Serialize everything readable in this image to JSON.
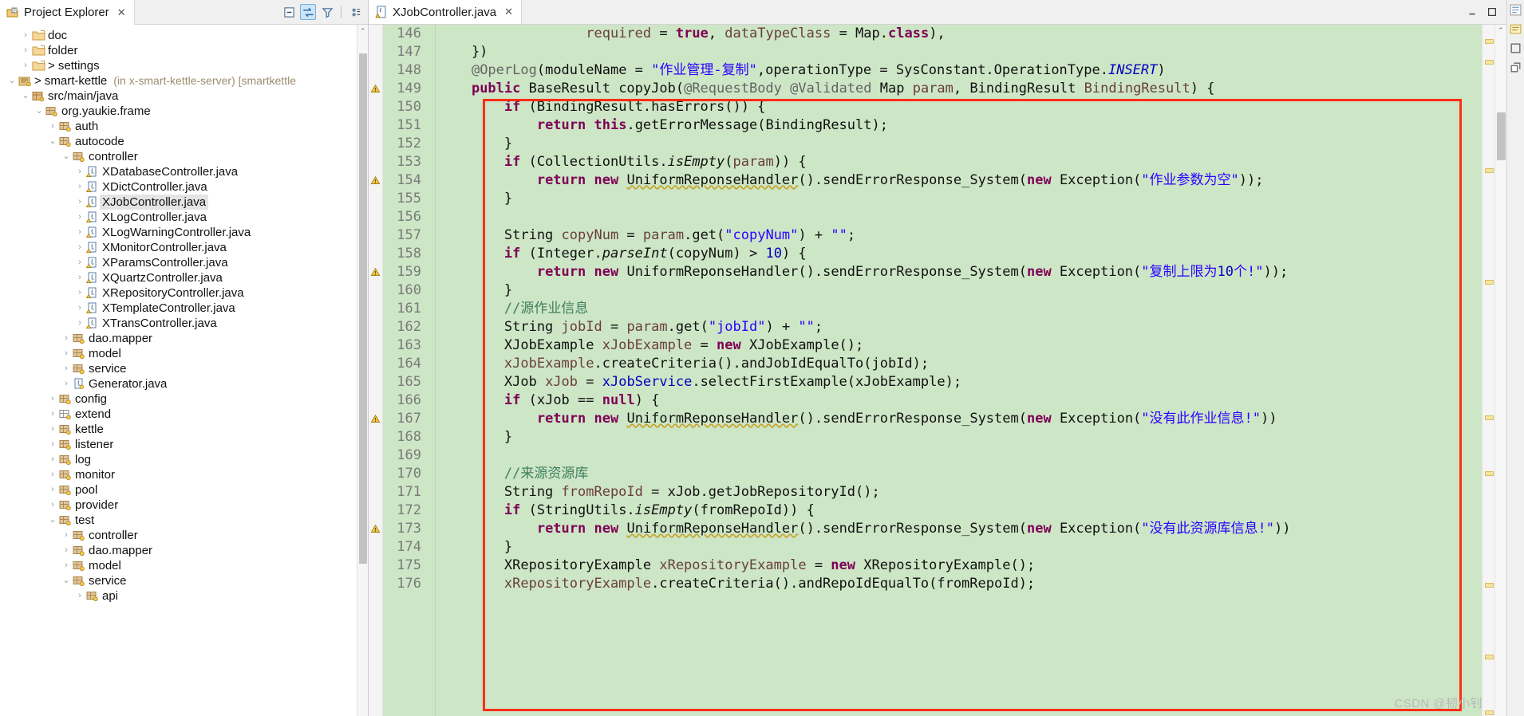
{
  "explorer": {
    "tab_title": "Project Explorer",
    "tab_close": "✕",
    "toolbar": [
      {
        "name": "collapse-all-icon",
        "title": "Collapse All"
      },
      {
        "name": "link-with-editor-icon",
        "title": "Link with Editor"
      },
      {
        "name": "view-menu-filter-icon",
        "title": "Filters"
      },
      {
        "name": "view-menu-icon",
        "title": "View Menu"
      }
    ],
    "tree": [
      {
        "label": "doc",
        "indent": 1,
        "twisty": "collapsed",
        "icon": "folder-icon"
      },
      {
        "label": "folder",
        "indent": 1,
        "twisty": "collapsed",
        "icon": "folder-icon"
      },
      {
        "label": "> settings",
        "indent": 1,
        "twisty": "collapsed",
        "icon": "folder-icon"
      },
      {
        "label": "> smart-kettle",
        "sub": "(in x-smart-kettle-server) [smartkettle",
        "indent": 0,
        "twisty": "expanded",
        "icon": "java-project-icon"
      },
      {
        "label": "src/main/java",
        "indent": 1,
        "twisty": "expanded",
        "icon": "source-folder-icon"
      },
      {
        "label": "org.yaukie.frame",
        "indent": 2,
        "twisty": "expanded",
        "icon": "package-icon"
      },
      {
        "label": "auth",
        "indent": 3,
        "twisty": "collapsed",
        "icon": "package-icon"
      },
      {
        "label": "autocode",
        "indent": 3,
        "twisty": "expanded",
        "icon": "package-icon"
      },
      {
        "label": "controller",
        "indent": 4,
        "twisty": "expanded",
        "icon": "package-icon"
      },
      {
        "label": "XDatabaseController.java",
        "indent": 5,
        "twisty": "collapsed",
        "icon": "java-file-warning-icon"
      },
      {
        "label": "XDictController.java",
        "indent": 5,
        "twisty": "collapsed",
        "icon": "java-file-warning-icon"
      },
      {
        "label": "XJobController.java",
        "indent": 5,
        "twisty": "collapsed",
        "icon": "java-file-warning-icon",
        "selected": true
      },
      {
        "label": "XLogController.java",
        "indent": 5,
        "twisty": "collapsed",
        "icon": "java-file-warning-icon"
      },
      {
        "label": "XLogWarningController.java",
        "indent": 5,
        "twisty": "collapsed",
        "icon": "java-file-warning-icon"
      },
      {
        "label": "XMonitorController.java",
        "indent": 5,
        "twisty": "collapsed",
        "icon": "java-file-warning-icon"
      },
      {
        "label": "XParamsController.java",
        "indent": 5,
        "twisty": "collapsed",
        "icon": "java-file-warning-icon"
      },
      {
        "label": "XQuartzController.java",
        "indent": 5,
        "twisty": "collapsed",
        "icon": "java-file-warning-icon"
      },
      {
        "label": "XRepositoryController.java",
        "indent": 5,
        "twisty": "collapsed",
        "icon": "java-file-warning-icon"
      },
      {
        "label": "XTemplateController.java",
        "indent": 5,
        "twisty": "collapsed",
        "icon": "java-file-warning-icon"
      },
      {
        "label": "XTransController.java",
        "indent": 5,
        "twisty": "collapsed",
        "icon": "java-file-warning-icon"
      },
      {
        "label": "dao.mapper",
        "indent": 4,
        "twisty": "collapsed",
        "icon": "package-icon"
      },
      {
        "label": "model",
        "indent": 4,
        "twisty": "collapsed",
        "icon": "package-icon"
      },
      {
        "label": "service",
        "indent": 4,
        "twisty": "collapsed",
        "icon": "package-icon"
      },
      {
        "label": "Generator.java",
        "indent": 4,
        "twisty": "collapsed",
        "icon": "java-file-icon"
      },
      {
        "label": "config",
        "indent": 3,
        "twisty": "collapsed",
        "icon": "package-icon"
      },
      {
        "label": "extend",
        "indent": 3,
        "twisty": "collapsed",
        "icon": "package-empty-icon"
      },
      {
        "label": "kettle",
        "indent": 3,
        "twisty": "collapsed",
        "icon": "package-icon"
      },
      {
        "label": "listener",
        "indent": 3,
        "twisty": "collapsed",
        "icon": "package-icon"
      },
      {
        "label": "log",
        "indent": 3,
        "twisty": "collapsed",
        "icon": "package-icon"
      },
      {
        "label": "monitor",
        "indent": 3,
        "twisty": "collapsed",
        "icon": "package-icon"
      },
      {
        "label": "pool",
        "indent": 3,
        "twisty": "collapsed",
        "icon": "package-icon"
      },
      {
        "label": "provider",
        "indent": 3,
        "twisty": "collapsed",
        "icon": "package-icon"
      },
      {
        "label": "test",
        "indent": 3,
        "twisty": "expanded",
        "icon": "package-icon"
      },
      {
        "label": "controller",
        "indent": 4,
        "twisty": "collapsed",
        "icon": "package-icon"
      },
      {
        "label": "dao.mapper",
        "indent": 4,
        "twisty": "collapsed",
        "icon": "package-icon"
      },
      {
        "label": "model",
        "indent": 4,
        "twisty": "collapsed",
        "icon": "package-icon"
      },
      {
        "label": "service",
        "indent": 4,
        "twisty": "expanded",
        "icon": "package-icon"
      },
      {
        "label": "api",
        "indent": 5,
        "twisty": "collapsed",
        "icon": "package-icon"
      }
    ],
    "scrollbar": {
      "up_arrow": "⌃",
      "down_arrow": "⌄"
    }
  },
  "editor": {
    "tab_title": "XJobController.java",
    "tab_close": "✕",
    "tab_icon": "java-file-warning-icon",
    "first_line": 146,
    "lines": [
      {
        "n": 146,
        "annot": "",
        "html": "                  <span class=\"param\">required</span> = <span class=\"kw\">true</span>, <span class=\"param\">dataTypeClass</span> = Map.<span class=\"kw\">class</span>),"
      },
      {
        "n": 147,
        "annot": "",
        "html": "    })"
      },
      {
        "n": 148,
        "annot": "",
        "html": "    <span class=\"ann\">@OperLog</span>(moduleName = <span class=\"str\">\"作业管理-复制\"</span>,operationType = SysConstant.OperationType.<span class=\"fld stat\">INSERT</span>)"
      },
      {
        "n": 149,
        "annot": "warning",
        "html": "    <span class=\"kw\">public</span> BaseResult copyJob(<span class=\"ann\">@RequestBody</span> <span class=\"ann\">@Validated</span> Map <span class=\"param\">param</span>, BindingResult <span class=\"param\">BindingResult</span>) {"
      },
      {
        "n": 150,
        "annot": "",
        "html": "        <span class=\"kw\">if</span> (BindingResult.hasErrors()) {"
      },
      {
        "n": 151,
        "annot": "",
        "html": "            <span class=\"kw\">return</span> <span class=\"kw\">this</span>.getErrorMessage(BindingResult);"
      },
      {
        "n": 152,
        "annot": "",
        "html": "        }"
      },
      {
        "n": 153,
        "annot": "",
        "html": "        <span class=\"kw\">if</span> (CollectionUtils.<span class=\"stat\">isEmpty</span>(<span class=\"param\">param</span>)) {"
      },
      {
        "n": 154,
        "annot": "warning",
        "html": "            <span class=\"kw\">return</span> <span class=\"kw\">new</span> <span class=\"wavy\">UniformReponseHandler</span>().sendErrorResponse_System(<span class=\"kw\">new</span> Exception(<span class=\"str\">\"作业参数为空\"</span>));"
      },
      {
        "n": 155,
        "annot": "",
        "html": "        }"
      },
      {
        "n": 156,
        "annot": "",
        "html": ""
      },
      {
        "n": 157,
        "annot": "",
        "html": "        String <span class=\"param\">copyNum</span> = <span class=\"param\">param</span>.get(<span class=\"str\">\"copyNum\"</span>) + <span class=\"str\">\"\"</span>;"
      },
      {
        "n": 158,
        "annot": "",
        "html": "        <span class=\"kw\">if</span> (Integer.<span class=\"stat\">parseInt</span>(copyNum) &gt; <span class=\"fld\">10</span>) {"
      },
      {
        "n": 159,
        "annot": "warning",
        "html": "            <span class=\"kw\">return</span> <span class=\"kw\">new</span> UniformReponseHandler().sendErrorResponse_System(<span class=\"kw\">new</span> Exception(<span class=\"str\">\"复制上限为</span><span class=\"fld\">10</span><span class=\"str\">个!\"</span>));"
      },
      {
        "n": 160,
        "annot": "",
        "html": "        }"
      },
      {
        "n": 161,
        "annot": "",
        "html": "        <span class=\"cmt\">//源作业信息</span>"
      },
      {
        "n": 162,
        "annot": "",
        "html": "        String <span class=\"param\">jobId</span> = <span class=\"param\">param</span>.get(<span class=\"str\">\"jobId\"</span>) + <span class=\"str\">\"\"</span>;"
      },
      {
        "n": 163,
        "annot": "",
        "html": "        XJobExample <span class=\"param\">xJobExample</span> = <span class=\"kw\">new</span> XJobExample();"
      },
      {
        "n": 164,
        "annot": "",
        "html": "        <span class=\"param\">xJobExample</span>.createCriteria().andJobIdEqualTo(jobId);"
      },
      {
        "n": 165,
        "annot": "",
        "html": "        XJob <span class=\"param\">xJob</span> = <span class=\"fld\">xJobService</span>.selectFirstExample(xJobExample);"
      },
      {
        "n": 166,
        "annot": "",
        "html": "        <span class=\"kw\">if</span> (xJob == <span class=\"kw\">null</span>) {"
      },
      {
        "n": 167,
        "annot": "warning",
        "html": "            <span class=\"kw\">return</span> <span class=\"kw\">new</span> <span class=\"wavy\">UniformReponseHandler</span>().sendErrorResponse_System(<span class=\"kw\">new</span> Exception(<span class=\"str\">\"没有此作业信息!\"</span>))"
      },
      {
        "n": 168,
        "annot": "",
        "html": "        }"
      },
      {
        "n": 169,
        "annot": "",
        "html": ""
      },
      {
        "n": 170,
        "annot": "",
        "html": "        <span class=\"cmt\">//来源资源库</span>"
      },
      {
        "n": 171,
        "annot": "",
        "html": "        String <span class=\"param\">fromRepoId</span> = xJob.getJobRepositoryId();"
      },
      {
        "n": 172,
        "annot": "",
        "html": "        <span class=\"kw\">if</span> (StringUtils.<span class=\"stat\">isEmpty</span>(fromRepoId)) {"
      },
      {
        "n": 173,
        "annot": "warning",
        "html": "            <span class=\"kw\">return</span> <span class=\"kw\">new</span> <span class=\"wavy\">UniformReponseHandler</span>().sendErrorResponse_System(<span class=\"kw\">new</span> Exception(<span class=\"str\">\"没有此资源库信息!\"</span>))"
      },
      {
        "n": 174,
        "annot": "",
        "html": "        }"
      },
      {
        "n": 175,
        "annot": "",
        "html": "        XRepositoryExample <span class=\"param\">xRepositoryExample</span> = <span class=\"kw\">new</span> XRepositoryExample();"
      },
      {
        "n": 176,
        "annot": "",
        "html": "        <span class=\"param\">xRepositoryExample</span>.createCriteria().andRepoIdEqualTo(fromRepoId);"
      }
    ],
    "markers": [
      18,
      44,
      180,
      320,
      490,
      560,
      700,
      790,
      860
    ],
    "scrollbar": {
      "up_arrow": "⌃",
      "down_arrow": "⌄"
    },
    "right_icons": [
      "outline-icon",
      "task-list-icon",
      "maximize-icon",
      "restore-icon"
    ]
  },
  "annotation": {
    "rect_color": "#ff2d17",
    "note": "red-highlight-rectangle"
  },
  "watermark": "CSDN @韧小钊",
  "colors": {
    "selection_green": "#cde6c6",
    "accent_blue": "#cce4f7",
    "string_blue": "#2a00ff",
    "keyword_purple": "#7f0055",
    "comment_green": "#3f7f5f"
  }
}
